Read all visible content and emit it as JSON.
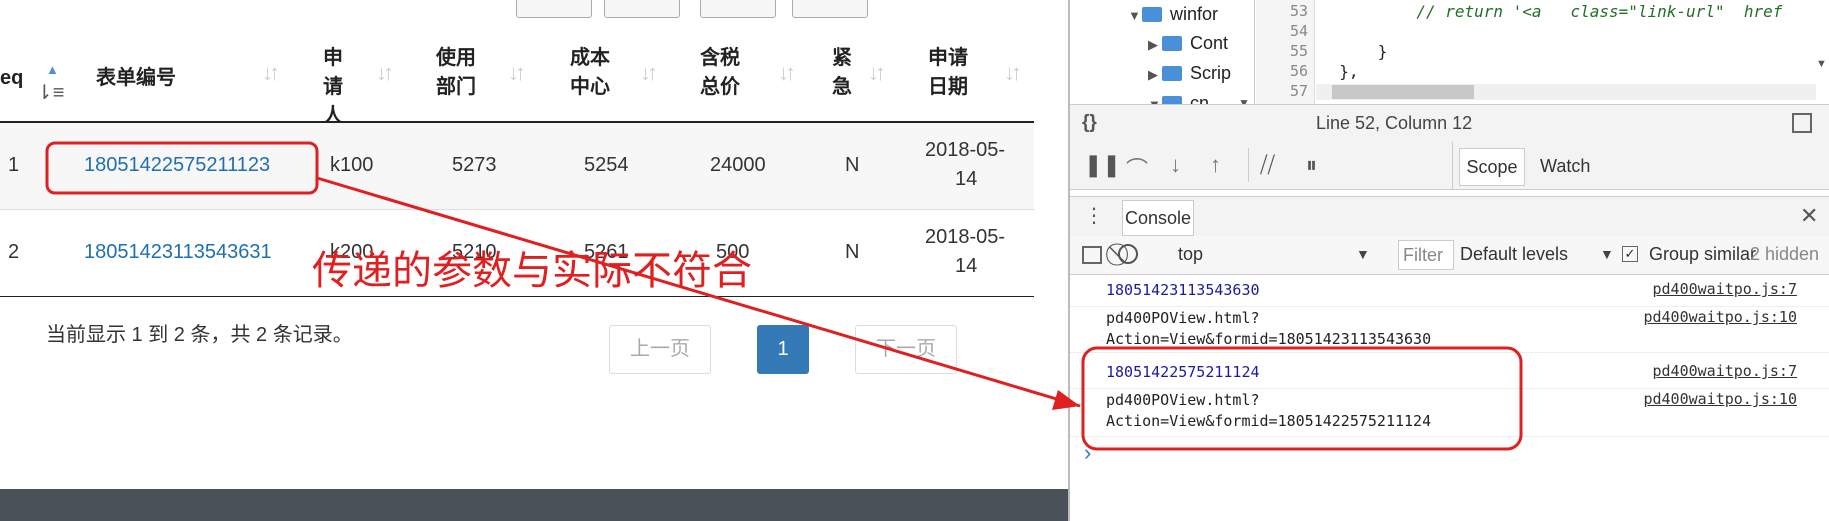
{
  "table": {
    "columns": [
      {
        "key": "seq",
        "label": "eq"
      },
      {
        "key": "form_no",
        "label": "表单编号"
      },
      {
        "key": "applicant",
        "label": "申请人"
      },
      {
        "key": "dept",
        "label": "使用部门"
      },
      {
        "key": "cost_center",
        "label": "成本中心"
      },
      {
        "key": "total_tax",
        "label": "含税总价"
      },
      {
        "key": "urgent",
        "label": "紧急"
      },
      {
        "key": "apply_date",
        "label": "申请日期"
      }
    ],
    "rows": [
      {
        "seq": "1",
        "form_no": "18051422575211123",
        "applicant": "k100",
        "dept": "5273",
        "cost_center": "5254",
        "total_tax": "24000",
        "urgent": "N",
        "apply_date_l1": "2018-05-",
        "apply_date_l2": "14"
      },
      {
        "seq": "2",
        "form_no": "18051423113543631",
        "applicant": "k200",
        "dept": "5210",
        "cost_center": "5261",
        "total_tax": "500",
        "urgent": "N",
        "apply_date_l1": "2018-05-",
        "apply_date_l2": "14"
      }
    ]
  },
  "pagination": {
    "summary": "当前显示 1 到 2 条，共 2 条记录。",
    "prev": "上一页",
    "current": "1",
    "next": "下一页"
  },
  "annotation": {
    "text": "传递的参数与实际不符合",
    "color": "#e02020"
  },
  "devtools": {
    "tree": [
      {
        "label": "winfor",
        "level": 1,
        "expanded": true
      },
      {
        "label": "Cont",
        "level": 2,
        "expanded": false
      },
      {
        "label": "Scrip",
        "level": 2,
        "expanded": false
      },
      {
        "label": "cn",
        "level": 2,
        "expanded": true
      }
    ],
    "code_lines": [
      {
        "num": "53",
        "text": "          // return '<a   class=\"link-url\"  href"
      },
      {
        "num": "54",
        "text": ""
      },
      {
        "num": "55",
        "text": "      }"
      },
      {
        "num": "56",
        "text": "  },"
      },
      {
        "num": "57",
        "text": ""
      }
    ],
    "status_text": "Line 52, Column 12",
    "sidebar_tabs": [
      "Scope",
      "Watch"
    ],
    "drawer_tab": "Console",
    "context": "top",
    "filter_placeholder": "Filter",
    "levels": "Default levels",
    "group_similar": "Group similar",
    "hidden_count": "2 hidden",
    "messages": [
      {
        "text": "18051423113543630",
        "source": "pd400waitpo.js:7",
        "numeric": true
      },
      {
        "text": "pd400POView.html?\nAction=View&formid=18051423113543630",
        "source": "pd400waitpo.js:10",
        "numeric": false
      },
      {
        "text": "18051422575211124",
        "source": "pd400waitpo.js:7",
        "numeric": true
      },
      {
        "text": "pd400POView.html?\nAction=View&formid=18051422575211124",
        "source": "pd400waitpo.js:10",
        "numeric": false
      }
    ],
    "prompt": "›"
  },
  "colors": {
    "link": "#1f6fb2",
    "pager_active": "#337ab7",
    "annotation": "#e02020"
  }
}
